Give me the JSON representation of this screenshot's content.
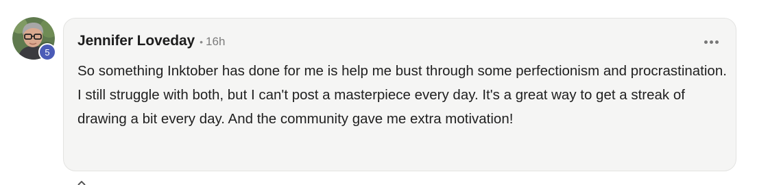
{
  "comment": {
    "author": {
      "name": "Jennifer Loveday",
      "avatar_icon": "user-avatar-photo",
      "level": "5",
      "level_badge_color": "#4b5bb7"
    },
    "separator": "•",
    "timestamp": "16h",
    "more_options_icon": "ellipsis-icon",
    "body": "So something Inktober has done for me is help me bust through some perfectionism and procrastination. I still struggle with both, but I can't post a masterpiece every day. It's a great way to get a streak of drawing a bit every day. And the community gave me extra motivation!"
  },
  "colors": {
    "card_background": "#f5f5f4",
    "card_border": "#e3e3e1",
    "text_primary": "#1c1c1c",
    "text_muted": "#7b7b7b"
  }
}
